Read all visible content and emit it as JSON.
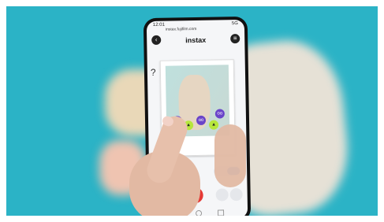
{
  "app": {
    "title": "instax",
    "url_partial": "instax.fujifilm.com",
    "status_left": "12:01",
    "status_right": "5G",
    "help_glyph": "?"
  },
  "photo_caption": "",
  "stickers": {
    "purple_symbol": "oo",
    "lime_symbol": "▲"
  },
  "icons": {
    "back": "chevron-left-icon",
    "menu": "menu-icon",
    "rotate": "rotate-icon"
  },
  "colors": {
    "background": "#2bb3c6",
    "shutter": "#e53935",
    "toggle_on": "#3b82f6",
    "sticker_purple": "#6a44c9",
    "sticker_lime": "#b6e63c"
  }
}
